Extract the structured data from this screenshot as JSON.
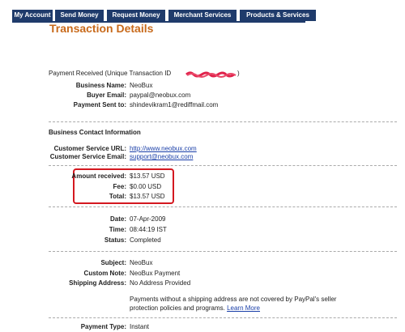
{
  "nav": {
    "tabs": [
      "My Account",
      "Send Money",
      "Request Money",
      "Merchant Services",
      "Products & Services"
    ]
  },
  "page": {
    "title": "Transaction Details"
  },
  "payment_received": {
    "prefix": "Payment Received",
    "unique_prefix": "(Unique Transaction ID",
    "suffix": ")"
  },
  "business": {
    "name_label": "Business Name:",
    "name": "NeoBux",
    "buyer_email_label": "Buyer Email:",
    "buyer_email": "paypal@neobux.com",
    "sent_to_label": "Payment Sent to:",
    "sent_to": "shindevikram1@rediffmail.com"
  },
  "contact": {
    "heading": "Business Contact Information",
    "url_label": "Customer Service URL:",
    "url": "http://www.neobux.com",
    "email_label": "Customer Service Email:",
    "email": "support@neobux.com"
  },
  "amounts": {
    "received_label": "Amount received:",
    "received": "$13.57 USD",
    "fee_label": "Fee:",
    "fee": "$0.00 USD",
    "total_label": "Total:",
    "total": "$13.57 USD"
  },
  "timing": {
    "date_label": "Date:",
    "date": "07-Apr-2009",
    "time_label": "Time:",
    "time": "08:44:19 IST",
    "status_label": "Status:",
    "status": "Completed"
  },
  "details": {
    "subject_label": "Subject:",
    "subject": "NeoBux",
    "note_label": "Custom Note:",
    "note": "NeoBux Payment",
    "shipping_label": "Shipping Address:",
    "shipping": "No Address Provided",
    "notice_line1": "Payments without a shipping address are not covered by PayPal's seller",
    "notice_line2": "protection policies and programs.",
    "learn_more": "Learn More"
  },
  "payment_type": {
    "label": "Payment Type:",
    "value": "Instant"
  },
  "colors": {
    "nav": "#1f3b6b",
    "title": "#c86a1b",
    "highlight": "#d41820",
    "link": "#1a3fa8"
  },
  "icons": [
    "redaction-scribble"
  ]
}
